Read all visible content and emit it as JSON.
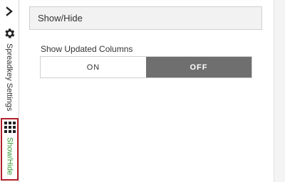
{
  "sidebar": {
    "collapse_icon": "chevron-right-icon",
    "tabs": [
      {
        "label": "Spreadkey Settings",
        "icon": "gear-icon"
      },
      {
        "label": "Show/Hide",
        "icon": "grid-icon",
        "active": true,
        "accent": "#3a9a3a",
        "border": "#b0202a"
      }
    ]
  },
  "panel": {
    "title": "Show/Hide",
    "field_label": "Show Updated Columns",
    "toggle": {
      "on_label": "ON",
      "off_label": "OFF",
      "selected": "OFF"
    }
  }
}
